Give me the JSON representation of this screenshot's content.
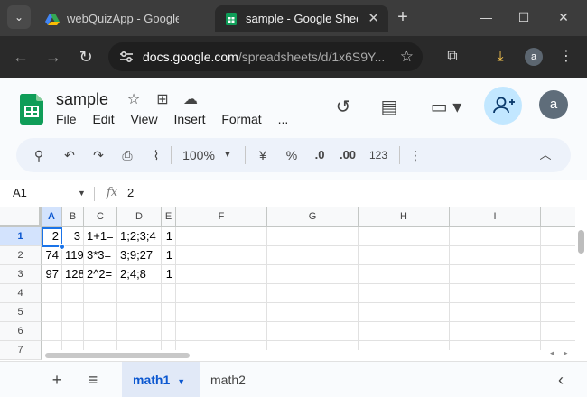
{
  "browser": {
    "tabs": [
      {
        "title": "webQuizApp - Google I",
        "active": false
      },
      {
        "title": "sample - Google Sheets",
        "active": true
      }
    ],
    "url_host": "docs.google.com",
    "url_path": "/spreadsheets/d/1x6S9Y...",
    "profile_initial": "a"
  },
  "doc": {
    "title": "sample",
    "menu": [
      "File",
      "Edit",
      "View",
      "Insert",
      "Format",
      "..."
    ],
    "account_initial": "a"
  },
  "toolbar": {
    "zoom": "100%",
    "currency": "¥",
    "percent": "%",
    "dec_decrease": ".0",
    "dec_increase": ".00",
    "number_format": "123"
  },
  "formula_bar": {
    "name_box": "A1",
    "fx": "fx",
    "formula": "2"
  },
  "grid": {
    "columns": [
      "A",
      "B",
      "C",
      "D",
      "E",
      "F",
      "G",
      "H",
      "I"
    ],
    "selected_column": "A",
    "rows": [
      "1",
      "2",
      "3",
      "4",
      "5",
      "6",
      "7"
    ],
    "selected_row": "1",
    "cells": [
      [
        "2",
        "3",
        "1+1=",
        "1;2;3;4",
        "1"
      ],
      [
        "74",
        "119",
        "3*3=",
        "3;9;27",
        "1"
      ],
      [
        "97",
        "128",
        "2^2=",
        "2;4;8",
        "1"
      ]
    ]
  },
  "sheets": [
    {
      "name": "math1",
      "active": true
    },
    {
      "name": "math2",
      "active": false
    }
  ]
}
